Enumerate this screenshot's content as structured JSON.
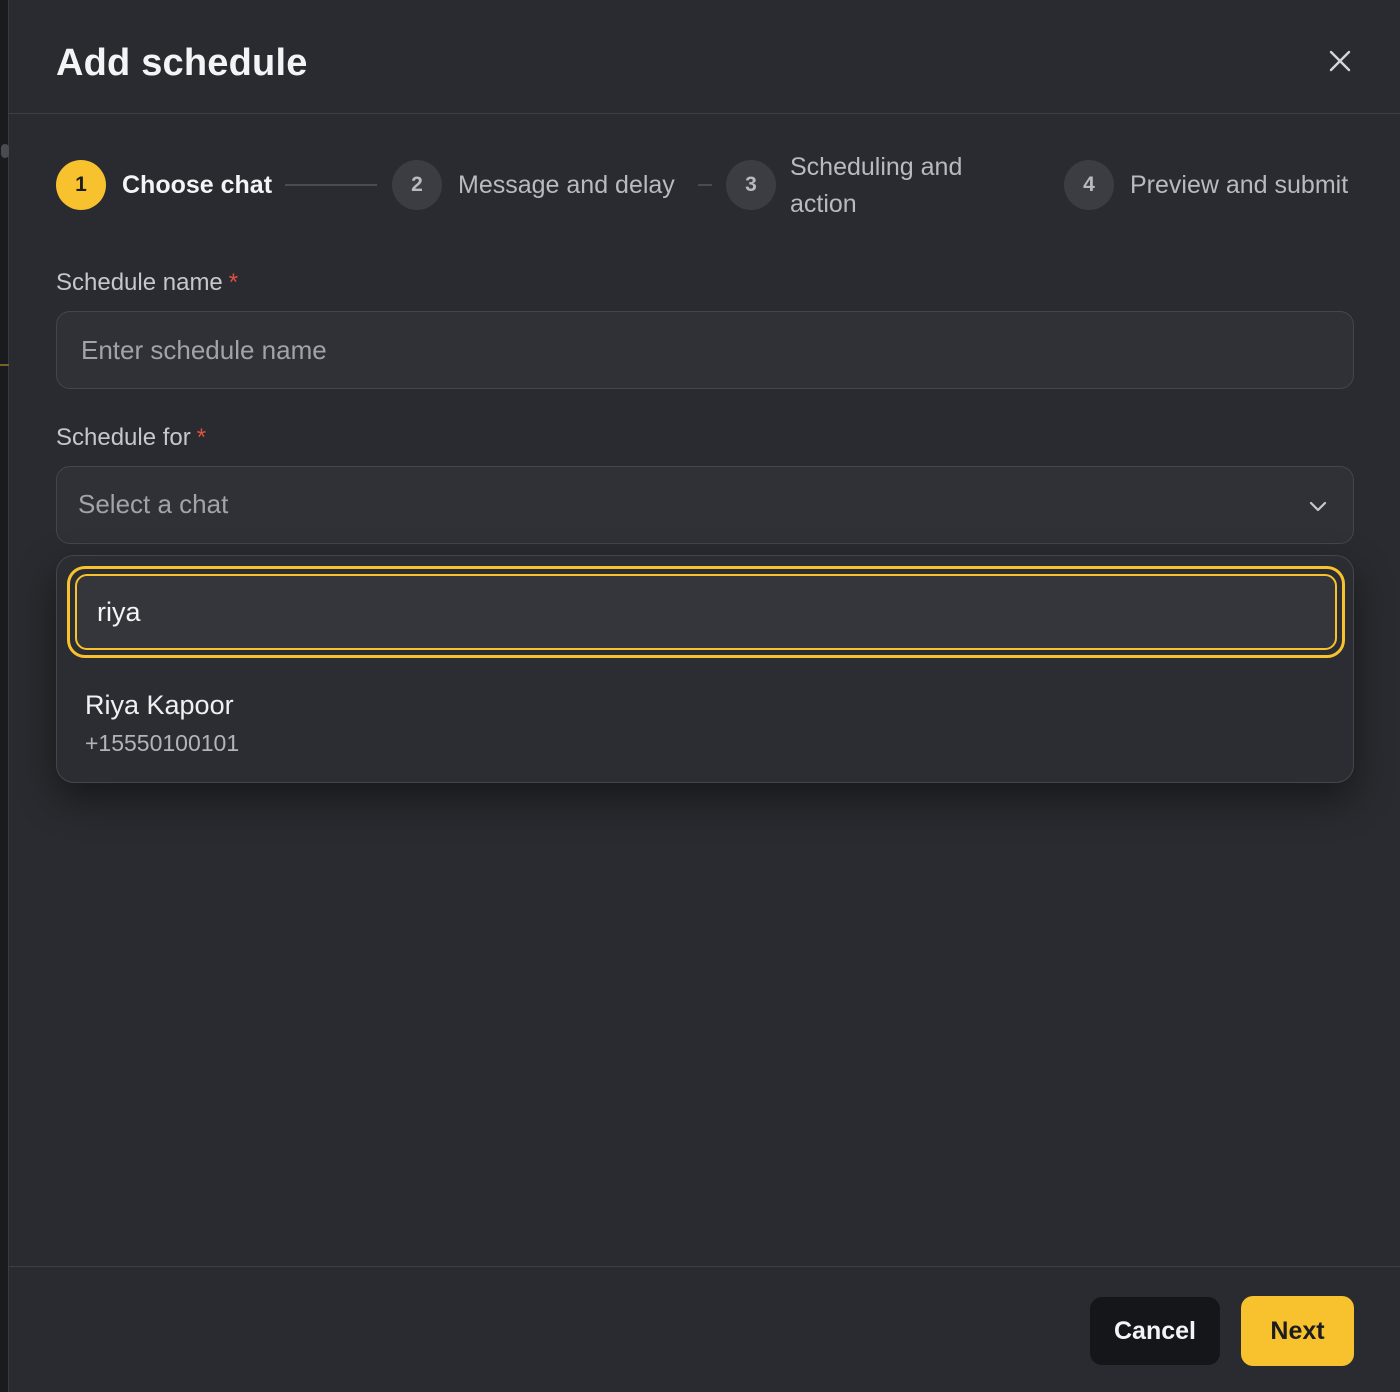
{
  "modal": {
    "title": "Add schedule"
  },
  "stepper": {
    "steps": [
      {
        "number": "1",
        "label": "Choose chat",
        "state": "active"
      },
      {
        "number": "2",
        "label": "Message and delay",
        "state": "idle"
      },
      {
        "number": "3",
        "label_line1": "Scheduling and",
        "label_line2": "action",
        "state": "idle"
      },
      {
        "number": "4",
        "label": "Preview and submit",
        "state": "idle"
      }
    ]
  },
  "form": {
    "schedule_name": {
      "label": "Schedule name",
      "required_mark": "*",
      "value": "",
      "placeholder": "Enter schedule name"
    },
    "schedule_for": {
      "label": "Schedule for",
      "required_mark": "*",
      "selected_value": "Select a chat",
      "search": {
        "value": "riya"
      },
      "options": [
        {
          "name": "Riya Kapoor",
          "phone": "+15550100101"
        }
      ]
    }
  },
  "footer": {
    "cancel_label": "Cancel",
    "next_label": "Next"
  },
  "colors": {
    "accent": "#f7c22e",
    "required": "#e0523f",
    "modal_bg": "#2a2b30"
  },
  "icons": {
    "close": "close-icon",
    "chevron": "chevron-down-icon"
  }
}
